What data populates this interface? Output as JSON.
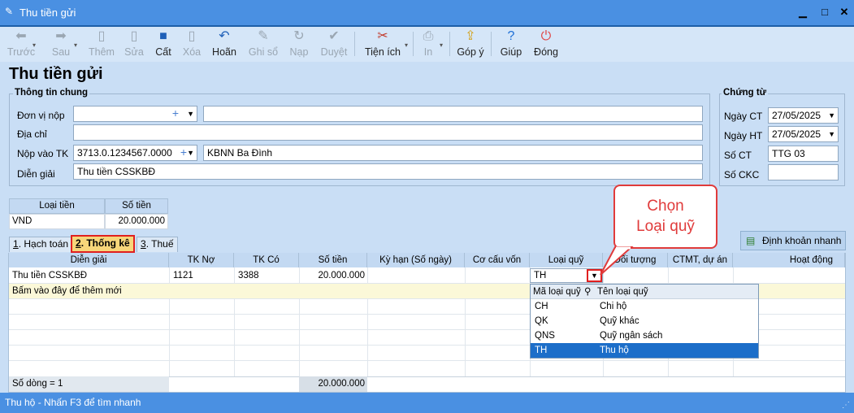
{
  "window": {
    "title": "Thu tiền gửi"
  },
  "toolbar": {
    "prev": "Trước",
    "next": "Sau",
    "add": "Thêm",
    "edit": "Sửa",
    "save": "Cất",
    "delete": "Xóa",
    "undo": "Hoãn",
    "post": "Ghi sổ",
    "load": "Nạp",
    "approve": "Duyệt",
    "utilities": "Tiện ích",
    "print": "In",
    "feedback": "Góp ý",
    "help": "Giúp",
    "close": "Đóng"
  },
  "form": {
    "title": "Thu tiền gửi",
    "general_group": "Thông tin chung",
    "payer_label": "Đơn vị nộp",
    "payer_value": "",
    "payer_name": "",
    "address_label": "Địa chỉ",
    "address_value": "",
    "account_label": "Nộp vào TK",
    "account_value": "3713.0.1234567.0000",
    "account_name": "KBNN Ba Đình",
    "desc_label": "Diễn giải",
    "desc_value": "Thu tiền CSSKBĐ"
  },
  "voucher": {
    "group": "Chứng từ",
    "date_label": "Ngày CT",
    "date_value": "27/05/2025",
    "hdate_label": "Ngày HT",
    "hdate_value": "27/05/2025",
    "no_label": "Số CT",
    "no_value": "TTG 03",
    "ckc_label": "Số CKC",
    "ckc_value": ""
  },
  "currency_table": {
    "headers": [
      "Loại tiền",
      "Số tiền"
    ],
    "row": [
      "VND",
      "20.000.000"
    ]
  },
  "tabs": [
    {
      "key": "1",
      "label": ". Hạch toán"
    },
    {
      "key": "2",
      "label": ". Thống kê"
    },
    {
      "key": "3",
      "label": ". Thuế"
    }
  ],
  "quick_entry": "Định khoản nhanh",
  "grid": {
    "headers": [
      "Diễn giải",
      "TK Nợ",
      "TK Có",
      "Số tiền",
      "Kỳ hạn (Số ngày)",
      "Cơ cấu vốn",
      "Loại quỹ",
      "Đối tượng",
      "CTMT, dự án",
      "Hoạt động"
    ],
    "row1": {
      "desc": "Thu tiền CSSKBĐ",
      "debit": "1121",
      "credit": "3388",
      "amount": "20.000.000",
      "fund": "TH"
    },
    "add_row": "Bấm vào đây để thêm mới",
    "footer_count": "Số dòng = 1",
    "footer_total": "20.000.000"
  },
  "popup": {
    "col1": "Mã loại quỹ",
    "col2": "Tên loại quỹ",
    "items": [
      {
        "code": "CH",
        "name": "Chi hộ"
      },
      {
        "code": "QK",
        "name": "Quỹ khác"
      },
      {
        "code": "QNS",
        "name": "Quỹ ngân sách"
      },
      {
        "code": "TH",
        "name": "Thu hộ"
      }
    ]
  },
  "callout": {
    "line1": "Chọn",
    "line2": "Loại quỹ"
  },
  "status": "Thu hộ - Nhấn F3 để tìm nhanh",
  "colors": {
    "titlebar": "#4a90e2",
    "highlight": "#e02020",
    "selected": "#1c6ec9"
  }
}
